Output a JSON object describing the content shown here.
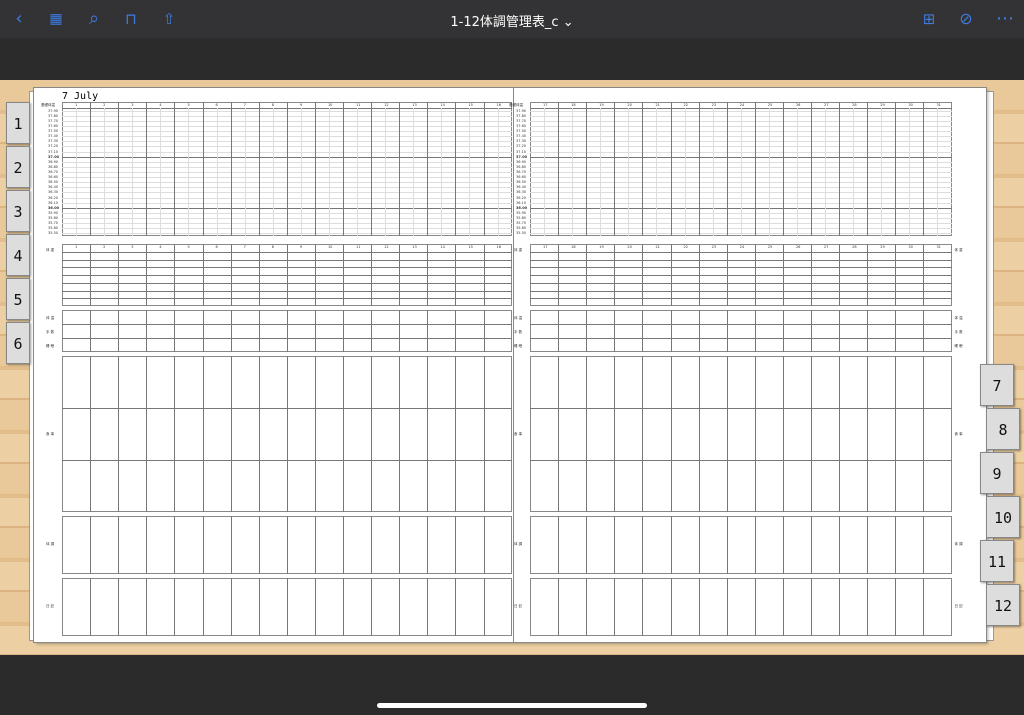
{
  "toolbar": {
    "title": "1-12体調管理表_c",
    "title_chevron": "⌄",
    "icons": [
      "back-icon",
      "grid-icon",
      "search-icon",
      "bookmark-icon",
      "share-icon",
      "add-page-icon",
      "pen-icon",
      "more-icon"
    ]
  },
  "document": {
    "month_label": "7 July",
    "temp_header": "基礎体温",
    "temp_ticks": [
      "37.90",
      "37.80",
      "37.70",
      "37.60",
      "37.50",
      "37.40",
      "37.30",
      "37.20",
      "37.10",
      "37.00",
      "36.90",
      "36.80",
      "36.70",
      "36.60",
      "36.50",
      "36.40",
      "36.30",
      "36.20",
      "36.10",
      "36.00",
      "35.90",
      "35.80",
      "35.70",
      "35.60",
      "35.50"
    ],
    "left_days": [
      "1",
      "2",
      "3",
      "4",
      "5",
      "6",
      "7",
      "8",
      "9",
      "10",
      "11",
      "12",
      "13",
      "14",
      "15",
      "16"
    ],
    "right_days": [
      "17",
      "18",
      "19",
      "20",
      "21",
      "22",
      "23",
      "24",
      "25",
      "26",
      "27",
      "28",
      "29",
      "30",
      "31"
    ],
    "section_labels": [
      "体 重",
      "体 温",
      "手 数",
      "睡 眠",
      "食 事",
      "体 調",
      "日 記"
    ],
    "left_tabs": [
      "1",
      "2",
      "3",
      "4",
      "5",
      "6"
    ],
    "right_tabs": [
      "7",
      "8",
      "9",
      "10",
      "11",
      "12"
    ]
  }
}
